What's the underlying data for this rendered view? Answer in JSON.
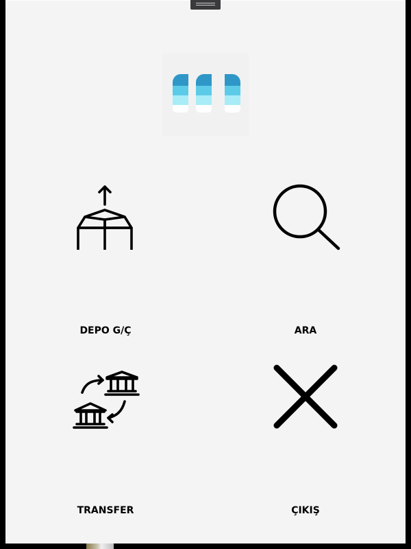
{
  "app": {
    "background": "#f4f4f4",
    "icon_color": "#000000",
    "logo_colors": [
      "#2f97c8",
      "#5ccbe8",
      "#a8ecf7",
      "#ffffff"
    ]
  },
  "menu": [
    {
      "id": "depo",
      "label": "DEPO G/Ç",
      "icon": "box-upload-icon"
    },
    {
      "id": "ara",
      "label": "ARA",
      "icon": "search-icon"
    },
    {
      "id": "transfer",
      "label": "TRANSFER",
      "icon": "bank-transfer-icon"
    },
    {
      "id": "cikis",
      "label": "ÇIKIŞ",
      "icon": "close-icon"
    }
  ]
}
